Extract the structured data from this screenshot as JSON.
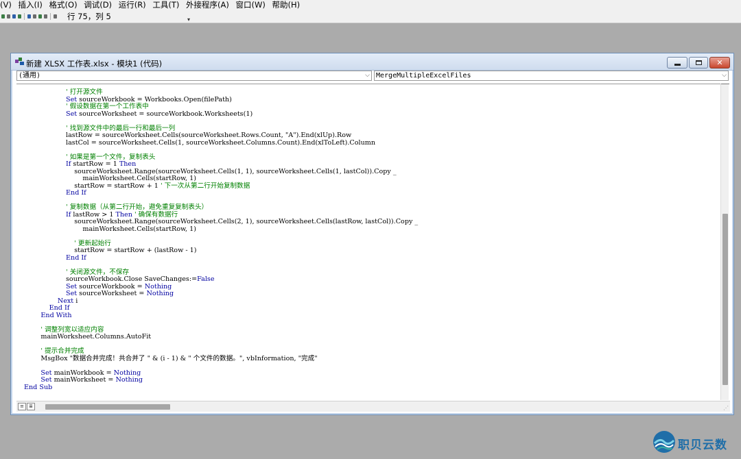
{
  "menubar": {
    "items": [
      "(V)",
      "插入(I)",
      "格式(O)",
      "调试(D)",
      "运行(R)",
      "工具(T)",
      "外接程序(A)",
      "窗口(W)",
      "帮助(H)"
    ]
  },
  "toolbar": {
    "position": "行 75，列 5"
  },
  "window": {
    "title": "新建 XLSX 工作表.xlsx - 模块1 (代码)",
    "object_combo": "(通用)",
    "procedure_combo": "MergeMultipleExcelFiles",
    "close_glyph": "✕"
  },
  "code": {
    "lines": [
      [
        {
          "t": "            ' 打开源文件",
          "c": "cm"
        }
      ],
      [
        {
          "t": "            ",
          "c": ""
        },
        {
          "t": "Set",
          "c": "kw"
        },
        {
          "t": " sourceWorkbook = Workbooks.Open(filePath)",
          "c": ""
        }
      ],
      [
        {
          "t": "            ' 假设数据在第一个工作表中",
          "c": "cm"
        }
      ],
      [
        {
          "t": "            ",
          "c": ""
        },
        {
          "t": "Set",
          "c": "kw"
        },
        {
          "t": " sourceWorksheet = sourceWorkbook.Worksheets(1)",
          "c": ""
        }
      ],
      [
        {
          "t": "",
          "c": ""
        }
      ],
      [
        {
          "t": "            ' 找到源文件中的最后一行和最后一列",
          "c": "cm"
        }
      ],
      [
        {
          "t": "            lastRow = sourceWorksheet.Cells(sourceWorksheet.Rows.Count, \"A\").End(xlUp).Row",
          "c": ""
        }
      ],
      [
        {
          "t": "            lastCol = sourceWorksheet.Cells(1, sourceWorksheet.Columns.Count).End(xlToLeft).Column",
          "c": ""
        }
      ],
      [
        {
          "t": "",
          "c": ""
        }
      ],
      [
        {
          "t": "            ' 如果是第一个文件，复制表头",
          "c": "cm"
        }
      ],
      [
        {
          "t": "            ",
          "c": ""
        },
        {
          "t": "If",
          "c": "kw"
        },
        {
          "t": " startRow = 1 ",
          "c": ""
        },
        {
          "t": "Then",
          "c": "kw"
        }
      ],
      [
        {
          "t": "                sourceWorksheet.Range(sourceWorksheet.Cells(1, 1), sourceWorksheet.Cells(1, lastCol)).Copy _",
          "c": ""
        }
      ],
      [
        {
          "t": "                    mainWorksheet.Cells(startRow, 1)",
          "c": ""
        }
      ],
      [
        {
          "t": "                startRow = startRow + 1 ",
          "c": ""
        },
        {
          "t": "' 下一次从第二行开始复制数据",
          "c": "cm"
        }
      ],
      [
        {
          "t": "            ",
          "c": ""
        },
        {
          "t": "End If",
          "c": "kw"
        }
      ],
      [
        {
          "t": "",
          "c": ""
        }
      ],
      [
        {
          "t": "            ' 复制数据（从第二行开始，避免重复复制表头）",
          "c": "cm"
        }
      ],
      [
        {
          "t": "            ",
          "c": ""
        },
        {
          "t": "If",
          "c": "kw"
        },
        {
          "t": " lastRow > 1 ",
          "c": ""
        },
        {
          "t": "Then",
          "c": "kw"
        },
        {
          "t": " ",
          "c": ""
        },
        {
          "t": "' 确保有数据行",
          "c": "cm"
        }
      ],
      [
        {
          "t": "                sourceWorksheet.Range(sourceWorksheet.Cells(2, 1), sourceWorksheet.Cells(lastRow, lastCol)).Copy _",
          "c": ""
        }
      ],
      [
        {
          "t": "                    mainWorksheet.Cells(startRow, 1)",
          "c": ""
        }
      ],
      [
        {
          "t": "",
          "c": ""
        }
      ],
      [
        {
          "t": "                ' 更新起始行",
          "c": "cm"
        }
      ],
      [
        {
          "t": "                startRow = startRow + (lastRow - 1)",
          "c": ""
        }
      ],
      [
        {
          "t": "            ",
          "c": ""
        },
        {
          "t": "End If",
          "c": "kw"
        }
      ],
      [
        {
          "t": "",
          "c": ""
        }
      ],
      [
        {
          "t": "            ' 关闭源文件，不保存",
          "c": "cm"
        }
      ],
      [
        {
          "t": "            sourceWorkbook.Close SaveChanges:=",
          "c": ""
        },
        {
          "t": "False",
          "c": "kw"
        }
      ],
      [
        {
          "t": "            ",
          "c": ""
        },
        {
          "t": "Set",
          "c": "kw"
        },
        {
          "t": " sourceWorkbook = ",
          "c": ""
        },
        {
          "t": "Nothing",
          "c": "kw"
        }
      ],
      [
        {
          "t": "            ",
          "c": ""
        },
        {
          "t": "Set",
          "c": "kw"
        },
        {
          "t": " sourceWorksheet = ",
          "c": ""
        },
        {
          "t": "Nothing",
          "c": "kw"
        }
      ],
      [
        {
          "t": "        ",
          "c": ""
        },
        {
          "t": "Next",
          "c": "kw"
        },
        {
          "t": " i",
          "c": ""
        }
      ],
      [
        {
          "t": "    ",
          "c": ""
        },
        {
          "t": "End If",
          "c": "kw"
        }
      ],
      [
        {
          "t": "",
          "c": ""
        },
        {
          "t": "End With",
          "c": "kw"
        }
      ],
      [
        {
          "t": "",
          "c": ""
        }
      ],
      [
        {
          "t": "' 调整列宽以适应内容",
          "c": "cm"
        }
      ],
      [
        {
          "t": "mainWorksheet.Columns.AutoFit",
          "c": ""
        }
      ],
      [
        {
          "t": "",
          "c": ""
        }
      ],
      [
        {
          "t": "' 提示合并完成",
          "c": "cm"
        }
      ],
      [
        {
          "t": "MsgBox \"数据合并完成！共合并了 \" & (i - 1) & \" 个文件的数据。\", vbInformation, \"完成\"",
          "c": ""
        }
      ],
      [
        {
          "t": "",
          "c": ""
        }
      ],
      [
        {
          "t": "",
          "c": ""
        },
        {
          "t": "Set",
          "c": "kw"
        },
        {
          "t": " mainWorkbook = ",
          "c": ""
        },
        {
          "t": "Nothing",
          "c": "kw"
        }
      ],
      [
        {
          "t": "",
          "c": ""
        },
        {
          "t": "Set",
          "c": "kw"
        },
        {
          "t": " mainWorksheet = ",
          "c": ""
        },
        {
          "t": "Nothing",
          "c": "kw"
        }
      ],
      [
        {
          "t": "End Sub",
          "c": "kw",
          "outdent": true
        }
      ]
    ]
  },
  "watermark": {
    "text": "职贝云数"
  },
  "colors": {
    "keyword": "#0000a0",
    "comment": "#008000",
    "text": "#000000",
    "background": "#ababab"
  }
}
